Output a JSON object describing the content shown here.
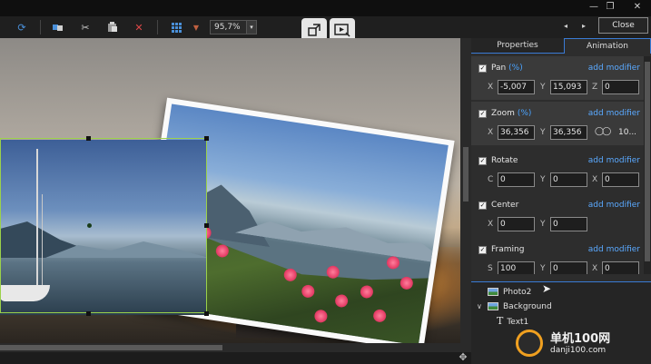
{
  "window": {
    "minimize": "—",
    "maximize": "❐",
    "close": "✕"
  },
  "toolbar": {
    "zoom_value": "95,7%",
    "zoom_dropdown": "▾",
    "nav_prev": "◂",
    "nav_next": "▸",
    "close_label": "Close",
    "icons": [
      "redo-icon",
      "duplicate-icon",
      "cut-icon",
      "paste-icon",
      "delete-icon",
      "grid-icon",
      "grid-dropdown-icon"
    ]
  },
  "panel": {
    "tabs": [
      {
        "label": "Properties",
        "active": false
      },
      {
        "label": "Animation",
        "active": true
      }
    ],
    "sections": [
      {
        "name": "Pan",
        "suffix": "(%)",
        "add_modifier": "add modifier",
        "fields": [
          {
            "label": "X",
            "value": "-5,007"
          },
          {
            "label": "Y",
            "value": "15,093"
          },
          {
            "label": "Z",
            "value": "0"
          }
        ]
      },
      {
        "name": "Zoom",
        "suffix": "(%)",
        "add_modifier": "add modifier",
        "fields": [
          {
            "label": "X",
            "value": "36,356"
          },
          {
            "label": "Y",
            "value": "36,356"
          }
        ],
        "link_value": "10..."
      },
      {
        "name": "Rotate",
        "suffix": "",
        "add_modifier": "add modifier",
        "fields": [
          {
            "label": "C",
            "value": "0"
          },
          {
            "label": "Y",
            "value": "0"
          },
          {
            "label": "X",
            "value": "0"
          }
        ]
      },
      {
        "name": "Center",
        "suffix": "",
        "add_modifier": "add modifier",
        "fields": [
          {
            "label": "X",
            "value": "0"
          },
          {
            "label": "Y",
            "value": "0"
          }
        ]
      },
      {
        "name": "Framing",
        "suffix": "",
        "add_modifier": "add modifier",
        "fields": [
          {
            "label": "S",
            "value": "100"
          },
          {
            "label": "Y",
            "value": "0"
          },
          {
            "label": "X",
            "value": "0"
          }
        ]
      }
    ],
    "layers": [
      {
        "name": "Photo2"
      },
      {
        "name": "Background"
      },
      {
        "name": "Text1"
      }
    ]
  },
  "watermark": {
    "title": "单机100网",
    "url": "danji100.com"
  },
  "colors": {
    "accent": "#3a7bd5",
    "link": "#5aa9ff",
    "selection": "#9bd14a",
    "delete": "#e04848"
  }
}
